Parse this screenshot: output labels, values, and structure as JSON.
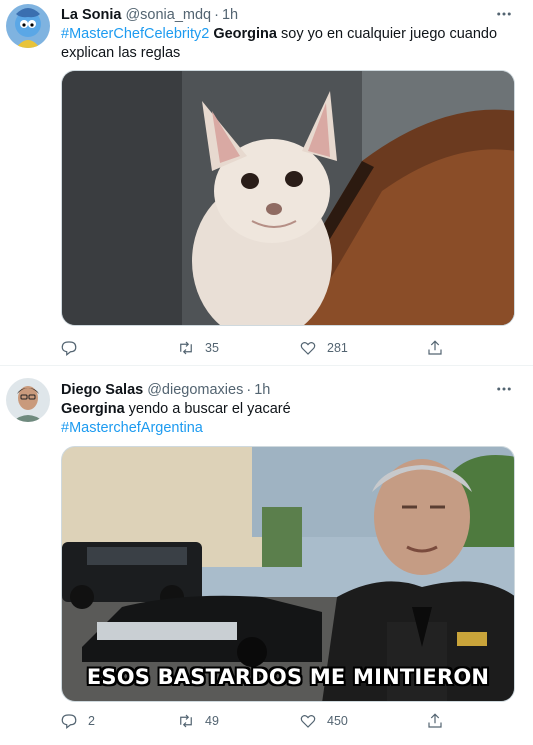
{
  "tweets": [
    {
      "display_name": "La Sonia",
      "handle": "@sonia_mdq",
      "separator": "·",
      "time": "1h",
      "hashtag": "#MasterChefCelebrity2",
      "bold_word": "Georgina",
      "text_rest": " soy yo en cualquier juego cuando explican las reglas",
      "replies": "",
      "retweets": "35",
      "likes": "281"
    },
    {
      "display_name": "Diego Salas",
      "handle": "@diegomaxies",
      "separator": "·",
      "time": "1h",
      "bold_word": "Georgina",
      "text_rest": " yendo a buscar el yacaré",
      "hashtag": "#MasterchefArgentina",
      "replies": "2",
      "retweets": "49",
      "likes": "450",
      "media_caption": "ESOS BASTARDOS ME MINTIERON"
    }
  ],
  "icons": {
    "more": "more-icon",
    "reply": "reply-icon",
    "retweet": "retweet-icon",
    "like": "like-icon",
    "share": "share-icon"
  },
  "colors": {
    "link": "#1d9bf0",
    "secondary": "#536471",
    "text": "#0f1419"
  }
}
